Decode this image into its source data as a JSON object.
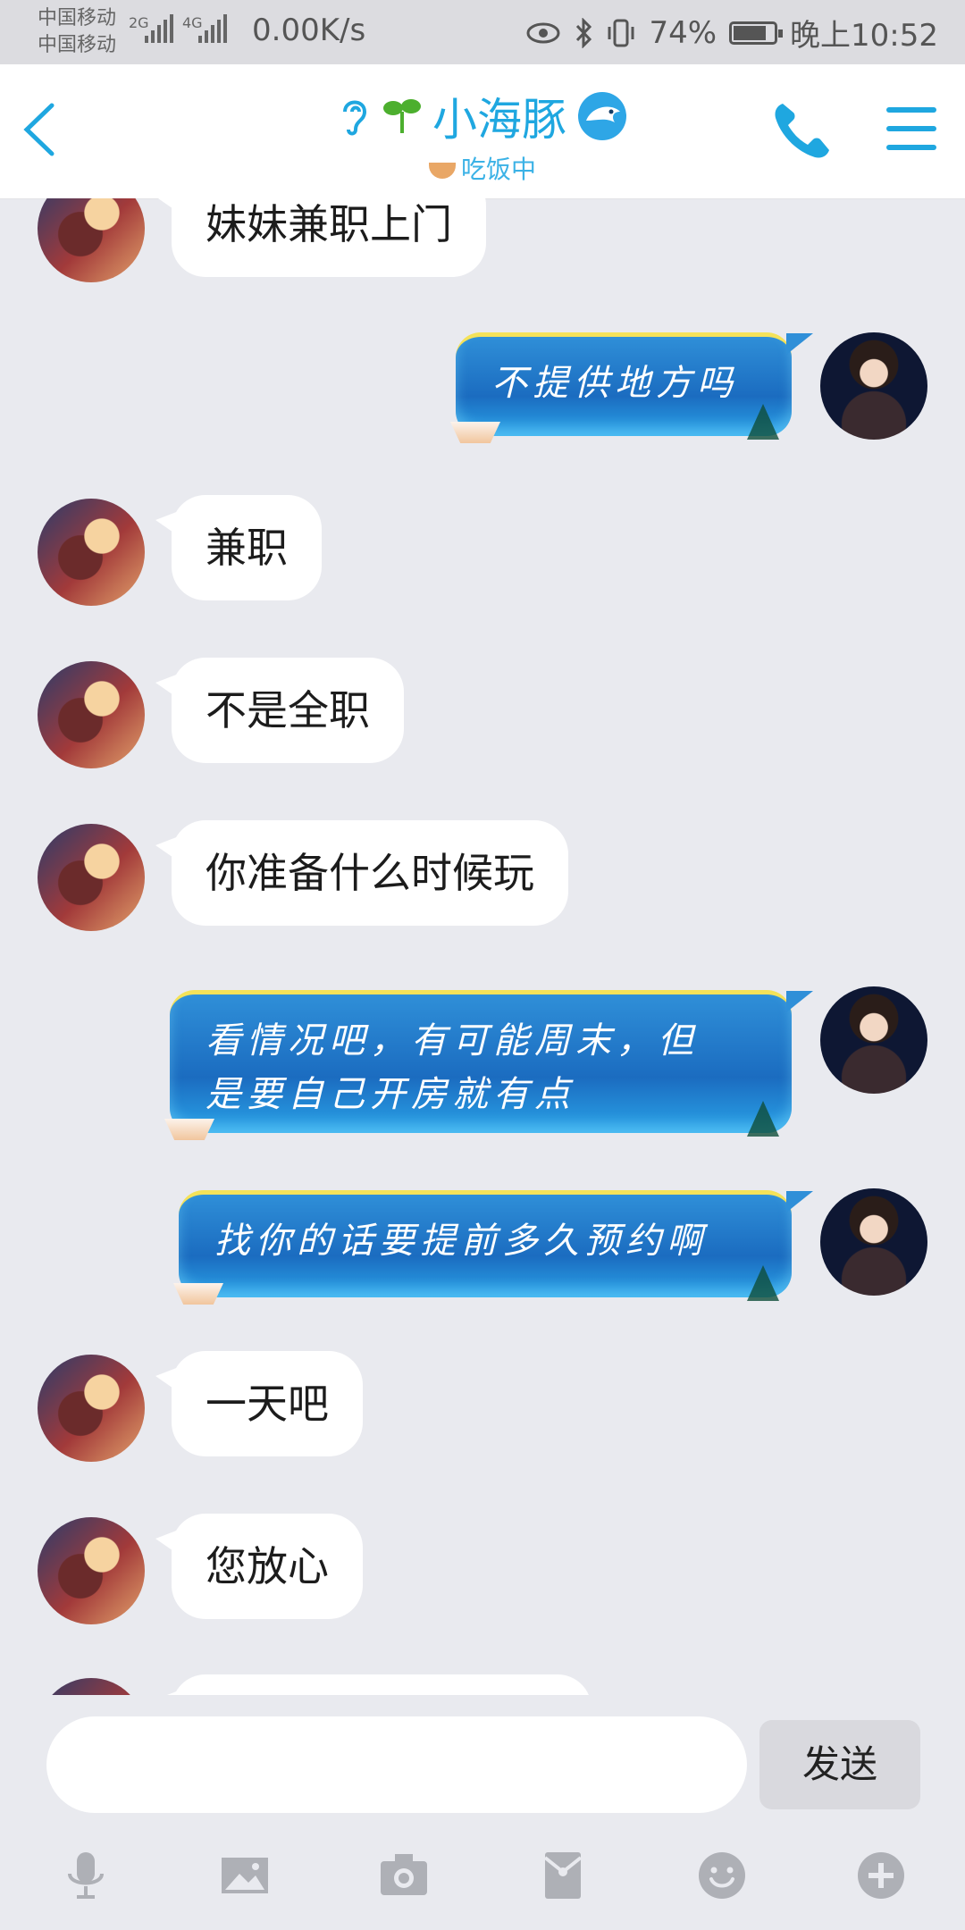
{
  "status_bar": {
    "carrier1": "中国移动",
    "carrier2": "中国移动",
    "sig1_label": "2G",
    "sig2_label": "4G",
    "speed": "0.00K/s",
    "battery": "74%",
    "battery_level": 0.74,
    "time": "晚上10:52"
  },
  "header": {
    "title": "小海豚",
    "subtitle": "吃饭中",
    "colors": {
      "accent": "#1fa7e0"
    }
  },
  "messages": [
    {
      "side": "other",
      "text": "妹妹兼职上门"
    },
    {
      "side": "self",
      "text": "不提供地方吗"
    },
    {
      "side": "other",
      "text": "兼职"
    },
    {
      "side": "other",
      "text": "不是全职"
    },
    {
      "side": "other",
      "text": "你准备什么时候玩"
    },
    {
      "side": "self",
      "line1": "看情况吧，有可能周末，但",
      "line2": "是要自己开房就有点"
    },
    {
      "side": "self",
      "text": "找你的话要提前多久预约啊"
    },
    {
      "side": "other",
      "text": "一天吧"
    },
    {
      "side": "other",
      "text": "您放心"
    }
  ],
  "input": {
    "placeholder": "",
    "send_label": "发送"
  },
  "toolbar": {
    "icons": [
      "microphone-icon",
      "image-icon",
      "camera-icon",
      "red-packet-icon",
      "emoji-icon",
      "plus-icon"
    ]
  }
}
